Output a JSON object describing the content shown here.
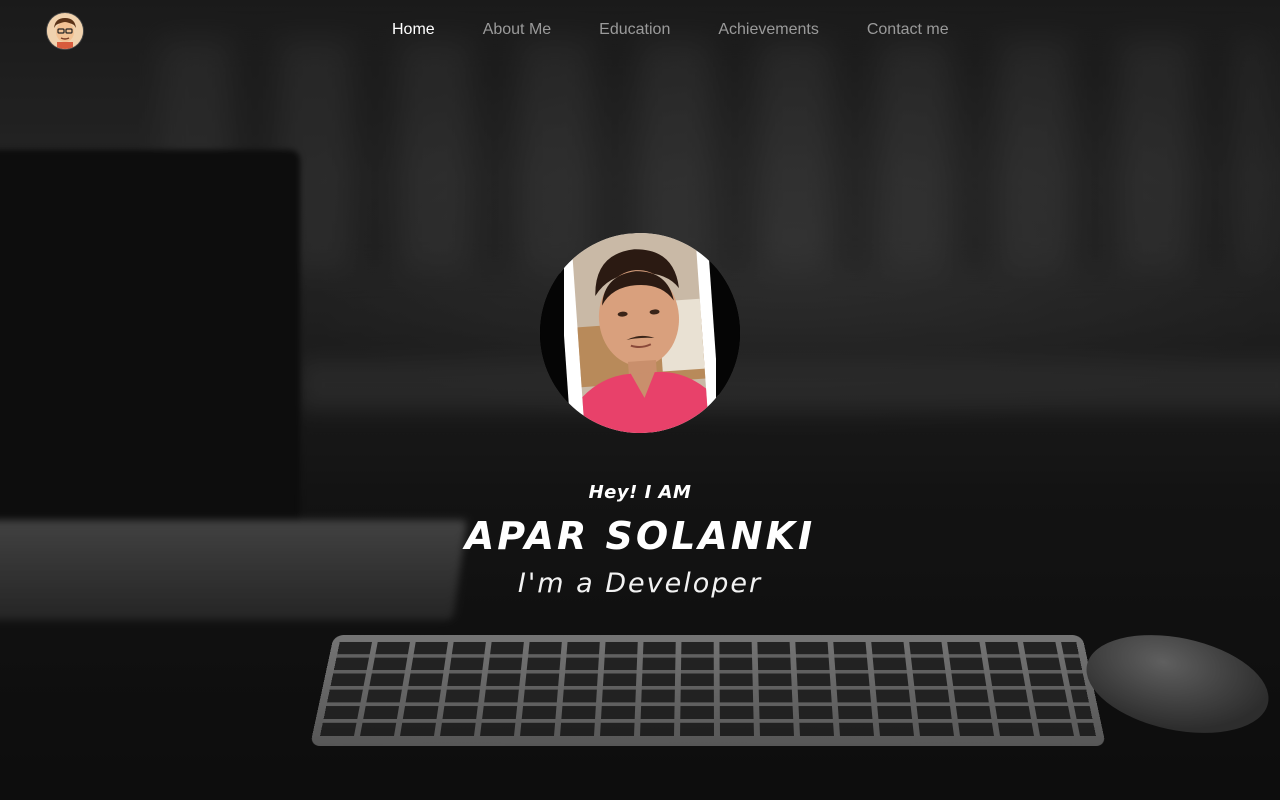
{
  "nav": {
    "logo_icon": "profile-avatar-icon",
    "items": [
      {
        "label": "Home",
        "active": true
      },
      {
        "label": "About Me",
        "active": false
      },
      {
        "label": "Education",
        "active": false
      },
      {
        "label": "Achievements",
        "active": false
      },
      {
        "label": "Contact me",
        "active": false
      }
    ]
  },
  "hero": {
    "greeting": "Hey! I AM",
    "name": "APAR SOLANKI",
    "role": "I'm a Developer"
  },
  "colors": {
    "nav_active": "#ffffff",
    "nav_inactive": "#9a9a9a",
    "shirt_accent": "#e8416a",
    "text": "#ffffff"
  }
}
